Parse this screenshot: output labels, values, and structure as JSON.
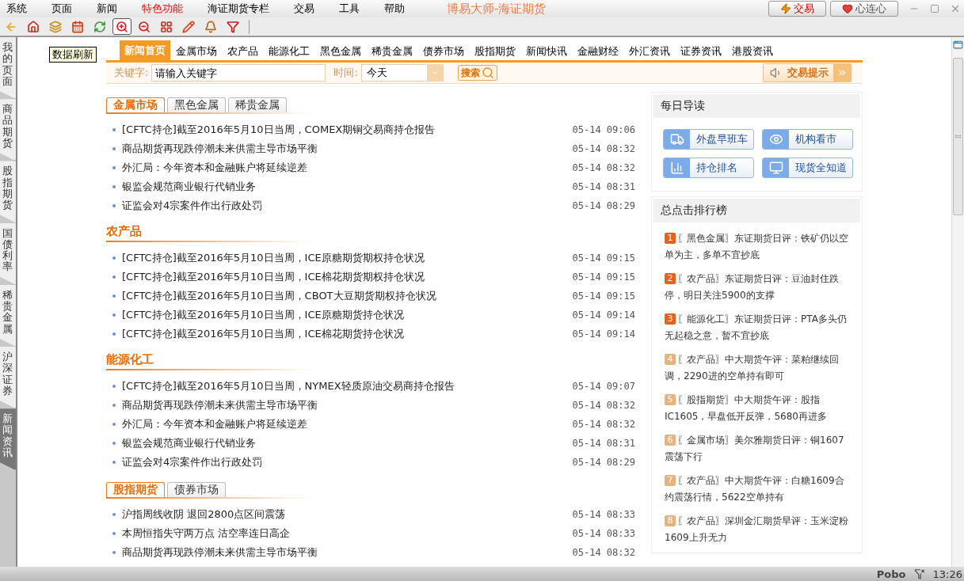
{
  "menu": [
    {
      "label": "系统",
      "selected": false
    },
    {
      "label": "页面",
      "selected": false
    },
    {
      "label": "新闻",
      "selected": false
    },
    {
      "label": "特色功能",
      "selected": true
    },
    {
      "label": "海证期货专栏",
      "selected": false
    },
    {
      "label": "交易",
      "selected": false
    },
    {
      "label": "工具",
      "selected": false
    },
    {
      "label": "帮助",
      "selected": false
    }
  ],
  "window": {
    "title": "博易大师-海证期货",
    "buttons": [
      {
        "kind": "trade",
        "label": "交易"
      },
      {
        "kind": "heart",
        "label": "心连心"
      }
    ]
  },
  "toolbar": [
    {
      "kind": "back",
      "selected": false
    },
    {
      "kind": "home",
      "selected": false
    },
    {
      "kind": "stack",
      "selected": false
    },
    {
      "kind": "calendar",
      "selected": false
    },
    {
      "kind": "refresh",
      "selected": false
    },
    {
      "kind": "zoom-in",
      "selected": true
    },
    {
      "kind": "zoom-out",
      "selected": false
    },
    {
      "kind": "windows",
      "selected": false
    },
    {
      "kind": "pen",
      "selected": false
    },
    {
      "kind": "bell",
      "selected": false
    },
    {
      "kind": "filter",
      "selected": false
    }
  ],
  "tooltip": "数据刷新",
  "sidebar": [
    {
      "label": "我的页面",
      "selected": false
    },
    {
      "label": "商品期货",
      "selected": false
    },
    {
      "label": "股指期货",
      "selected": false
    },
    {
      "label": "国债利率",
      "selected": false
    },
    {
      "label": "稀贵金属",
      "selected": false
    },
    {
      "label": "沪深证券",
      "selected": false
    },
    {
      "label": "新闻资讯",
      "selected": true
    }
  ],
  "nav_tabs": [
    {
      "label": "新闻首页",
      "selected": true
    },
    {
      "label": "金属市场",
      "selected": false
    },
    {
      "label": "农产品",
      "selected": false
    },
    {
      "label": "能源化工",
      "selected": false
    },
    {
      "label": "黑色金属",
      "selected": false
    },
    {
      "label": "稀贵金属",
      "selected": false
    },
    {
      "label": "债券市场",
      "selected": false
    },
    {
      "label": "股指期货",
      "selected": false
    },
    {
      "label": "新闻快讯",
      "selected": false
    },
    {
      "label": "金融财经",
      "selected": false
    },
    {
      "label": "外汇资讯",
      "selected": false
    },
    {
      "label": "证券资讯",
      "selected": false
    },
    {
      "label": "港股资讯",
      "selected": false
    }
  ],
  "search": {
    "keyword_label": "关键字:",
    "placeholder": "请输入关键字",
    "time_label": "时间:",
    "time_value": "今天",
    "search_button": "搜索",
    "alert_button": "交易提示"
  },
  "sections": [
    {
      "kind": "tabs",
      "tabs": [
        {
          "label": "金属市场",
          "selected": true
        },
        {
          "label": "黑色金属",
          "selected": false
        },
        {
          "label": "稀贵金属",
          "selected": false
        }
      ],
      "items": [
        {
          "title": "[CFTC持仓]截至2016年5月10日当周，COMEX期铜交易商持仓报告",
          "time": "05-14 09:06"
        },
        {
          "title": "商品期货再现跌停潮未来供需主导市场平衡",
          "time": "05-14 08:32"
        },
        {
          "title": "外汇局：今年资本和金融账户将延续逆差",
          "time": "05-14 08:32"
        },
        {
          "title": "银监会规范商业银行代销业务",
          "time": "05-14 08:31"
        },
        {
          "title": "证监会对4宗案件作出行政处罚",
          "time": "05-14 08:29"
        }
      ]
    },
    {
      "kind": "heading",
      "tabs": [
        {
          "label": "农产品",
          "selected": true
        }
      ],
      "items": [
        {
          "title": "[CFTC持仓]截至2016年5月10日当周，ICE原糖期货期权持仓状况",
          "time": "05-14 09:15"
        },
        {
          "title": "[CFTC持仓]截至2016年5月10日当周，ICE棉花期货期权持仓状况",
          "time": "05-14 09:15"
        },
        {
          "title": "[CFTC持仓]截至2016年5月10日当周，CBOT大豆期货期权持仓状况",
          "time": "05-14 09:15"
        },
        {
          "title": "[CFTC持仓]截至2016年5月10日当周，ICE原糖期货持仓状况",
          "time": "05-14 09:14"
        },
        {
          "title": "[CFTC持仓]截至2016年5月10日当周，ICE棉花期货持仓状况",
          "time": "05-14 09:14"
        }
      ]
    },
    {
      "kind": "heading",
      "tabs": [
        {
          "label": "能源化工",
          "selected": true
        }
      ],
      "items": [
        {
          "title": "[CFTC持仓]截至2016年5月10日当周，NYMEX轻质原油交易商持仓报告",
          "time": "05-14 09:07"
        },
        {
          "title": "商品期货再现跌停潮未来供需主导市场平衡",
          "time": "05-14 08:32"
        },
        {
          "title": "外汇局：今年资本和金融账户将延续逆差",
          "time": "05-14 08:32"
        },
        {
          "title": "银监会规范商业银行代销业务",
          "time": "05-14 08:31"
        },
        {
          "title": "证监会对4宗案件作出行政处罚",
          "time": "05-14 08:29"
        }
      ]
    },
    {
      "kind": "tabs",
      "tabs": [
        {
          "label": "股指期货",
          "selected": true
        },
        {
          "label": "债券市场",
          "selected": false
        }
      ],
      "items": [
        {
          "title": "沪指周线收阴 退回2800点区间震荡",
          "time": "05-14 08:33"
        },
        {
          "title": "本周恒指失守两万点 沽空率连日高企",
          "time": "05-14 08:33"
        },
        {
          "title": "商品期货再现跌停潮未来供需主导市场平衡",
          "time": "05-14 08:32"
        }
      ]
    }
  ],
  "daily": {
    "title": "每日导读",
    "buttons": [
      {
        "kind": "truck",
        "label": "外盘早班车"
      },
      {
        "kind": "eye",
        "label": "机构看市"
      },
      {
        "kind": "chart",
        "label": "持仓排名"
      },
      {
        "kind": "monitor",
        "label": "现货全知道"
      }
    ]
  },
  "ranking": {
    "title": "总点击排行榜",
    "items": [
      {
        "rank": "1",
        "color": "#e8601c",
        "text": "〖黑色金属〗东证期货日评：铁矿仍以空单为主，多单不宜抄底"
      },
      {
        "rank": "2",
        "color": "#e8601c",
        "text": "〖农产品〗东证期货日评：豆油封住跌停，明日关注5900的支撑"
      },
      {
        "rank": "3",
        "color": "#e8601c",
        "text": "〖能源化工〗东证期货日评：PTA多头仍无起稳之意，暂不宜抄底"
      },
      {
        "rank": "4",
        "color": "#e8b27c",
        "text": "〖农产品〗中大期货午评：菜粕继续回调，2290进的空单持有即可"
      },
      {
        "rank": "5",
        "color": "#e8b27c",
        "text": "〖股指期货〗中大期货午评：股指IC1605，早盘低开反弹，5680再进多"
      },
      {
        "rank": "6",
        "color": "#e8b27c",
        "text": "〖金属市场〗美尔雅期货日评：铜1607震荡下行"
      },
      {
        "rank": "7",
        "color": "#e8b27c",
        "text": "〖农产品〗中大期货午评：白糖1609合约震荡行情，5622空单持有"
      },
      {
        "rank": "8",
        "color": "#e8b27c",
        "text": "〖农产品〗深圳金汇期货早评：玉米淀粉1609上升无力"
      }
    ]
  },
  "status_bar": {
    "brand": "Pobo",
    "time": "13:26"
  }
}
